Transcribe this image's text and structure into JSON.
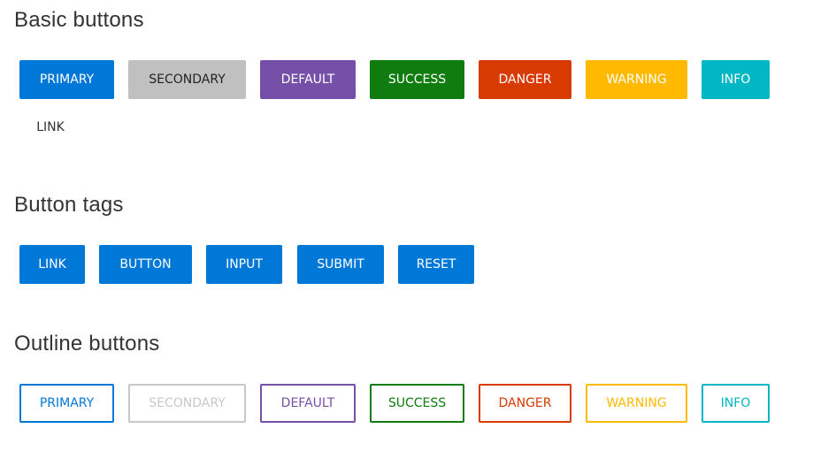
{
  "sections": {
    "basic": {
      "title": "Basic buttons",
      "buttons": [
        {
          "label": "PRIMARY",
          "variant": "primary",
          "color": "#0078d7",
          "text_color": "#ffffff"
        },
        {
          "label": "SECONDARY",
          "variant": "secondary",
          "color": "#c0c0c0",
          "text_color": "#222222"
        },
        {
          "label": "DEFAULT",
          "variant": "default",
          "color": "#7650a8",
          "text_color": "#ffffff"
        },
        {
          "label": "SUCCESS",
          "variant": "success",
          "color": "#107c10",
          "text_color": "#ffffff"
        },
        {
          "label": "DANGER",
          "variant": "danger",
          "color": "#d83b01",
          "text_color": "#ffffff"
        },
        {
          "label": "WARNING",
          "variant": "warning",
          "color": "#ffb900",
          "text_color": "#ffffff"
        },
        {
          "label": "INFO",
          "variant": "info",
          "color": "#00b7c3",
          "text_color": "#ffffff"
        },
        {
          "label": "LINK",
          "variant": "link",
          "color": "transparent",
          "text_color": "#333333"
        }
      ]
    },
    "tags": {
      "title": "Button tags",
      "buttons": [
        {
          "label": "LINK",
          "tag": "a"
        },
        {
          "label": "BUTTON",
          "tag": "button"
        },
        {
          "label": "INPUT",
          "tag": "input"
        },
        {
          "label": "SUBMIT",
          "tag": "submit"
        },
        {
          "label": "RESET",
          "tag": "reset"
        }
      ],
      "color": "#0078d7"
    },
    "outline": {
      "title": "Outline buttons",
      "buttons": [
        {
          "label": "PRIMARY",
          "variant": "primary",
          "color": "#0078d7"
        },
        {
          "label": "SECONDARY",
          "variant": "secondary",
          "color": "#c8c8c8"
        },
        {
          "label": "DEFAULT",
          "variant": "default",
          "color": "#7650a8"
        },
        {
          "label": "SUCCESS",
          "variant": "success",
          "color": "#107c10"
        },
        {
          "label": "DANGER",
          "variant": "danger",
          "color": "#d83b01"
        },
        {
          "label": "WARNING",
          "variant": "warning",
          "color": "#ffb900"
        },
        {
          "label": "INFO",
          "variant": "info",
          "color": "#00b7c3"
        }
      ]
    }
  }
}
